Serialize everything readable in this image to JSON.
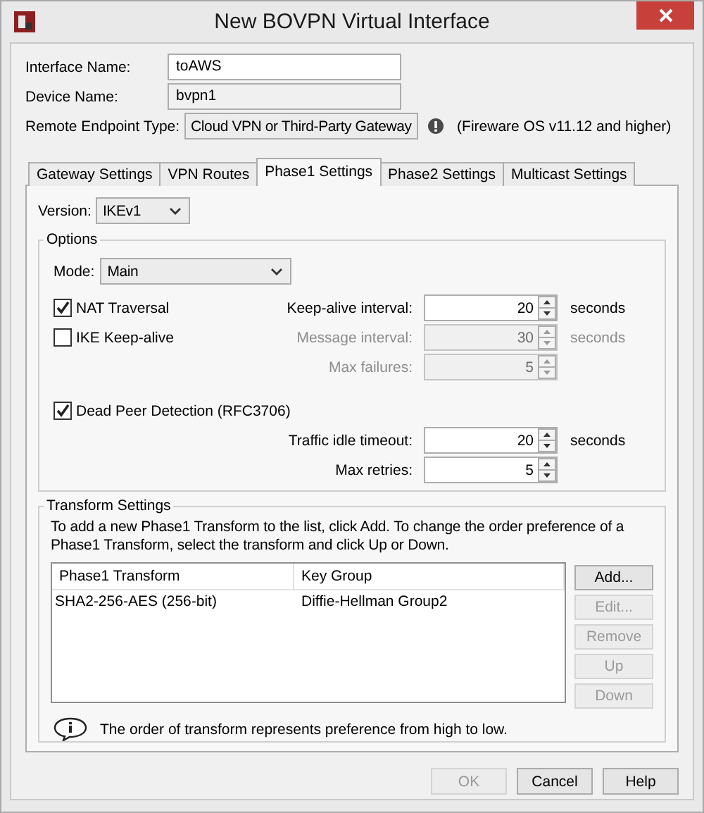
{
  "window": {
    "title": "New BOVPN Virtual Interface"
  },
  "interface_name": {
    "label": "Interface Name:",
    "value": "toAWS",
    "disabled": false
  },
  "device_name": {
    "label": "Device Name:",
    "value": "bvpn1",
    "disabled": true
  },
  "remote_endpoint": {
    "label": "Remote Endpoint Type:",
    "value": "Cloud VPN or Third-Party Gateway",
    "note": "(Fireware OS v11.12 and higher)"
  },
  "tabs": [
    {
      "label": "Gateway Settings",
      "selected": false
    },
    {
      "label": "VPN Routes",
      "selected": false
    },
    {
      "label": "Phase1 Settings",
      "selected": true
    },
    {
      "label": "Phase2 Settings",
      "selected": false
    },
    {
      "label": "Multicast Settings",
      "selected": false
    }
  ],
  "version": {
    "label": "Version:",
    "value": "IKEv1"
  },
  "options": {
    "title": "Options",
    "mode": {
      "label": "Mode:",
      "value": "Main"
    },
    "groups": [
      [
        {
          "checkbox": {
            "label": "NAT Traversal",
            "checked": true
          },
          "spinner": {
            "label": "Keep-alive interval:",
            "value": "20",
            "unit": "seconds",
            "disabled": false
          }
        },
        {
          "checkbox": {
            "label": "IKE Keep-alive",
            "checked": false
          },
          "spinner": {
            "label": "Message interval:",
            "value": "30",
            "unit": "seconds",
            "disabled": true
          }
        },
        {
          "spinner": {
            "label": "Max failures:",
            "value": "5",
            "disabled": true
          }
        }
      ],
      [
        {
          "checkbox": {
            "label": "Dead Peer Detection (RFC3706)",
            "checked": true
          }
        },
        {
          "spinner": {
            "label": "Traffic idle timeout:",
            "value": "20",
            "unit": "seconds",
            "disabled": false
          }
        },
        {
          "spinner": {
            "label": "Max retries:",
            "value": "5",
            "disabled": false
          }
        }
      ]
    ]
  },
  "transform_settings": {
    "title": "Transform Settings",
    "instructions": "To add a new Phase1 Transform to the list, click Add. To change the order preference of a Phase1 Transform, select the transform and click Up or Down.",
    "columns": [
      "Phase1 Transform",
      "Key Group"
    ],
    "rows": [
      [
        "SHA2-256-AES (256-bit)",
        "Diffie-Hellman Group2"
      ]
    ],
    "buttons": [
      {
        "label": "Add...",
        "disabled": false
      },
      {
        "label": "Edit...",
        "disabled": true
      },
      {
        "label": "Remove",
        "disabled": true
      },
      {
        "label": "Up",
        "disabled": true
      },
      {
        "label": "Down",
        "disabled": true
      }
    ],
    "note": "The order of transform represents preference from high to low."
  },
  "footer_buttons": [
    {
      "label": "OK",
      "disabled": true
    },
    {
      "label": "Cancel",
      "disabled": false
    },
    {
      "label": "Help",
      "disabled": false
    }
  ]
}
